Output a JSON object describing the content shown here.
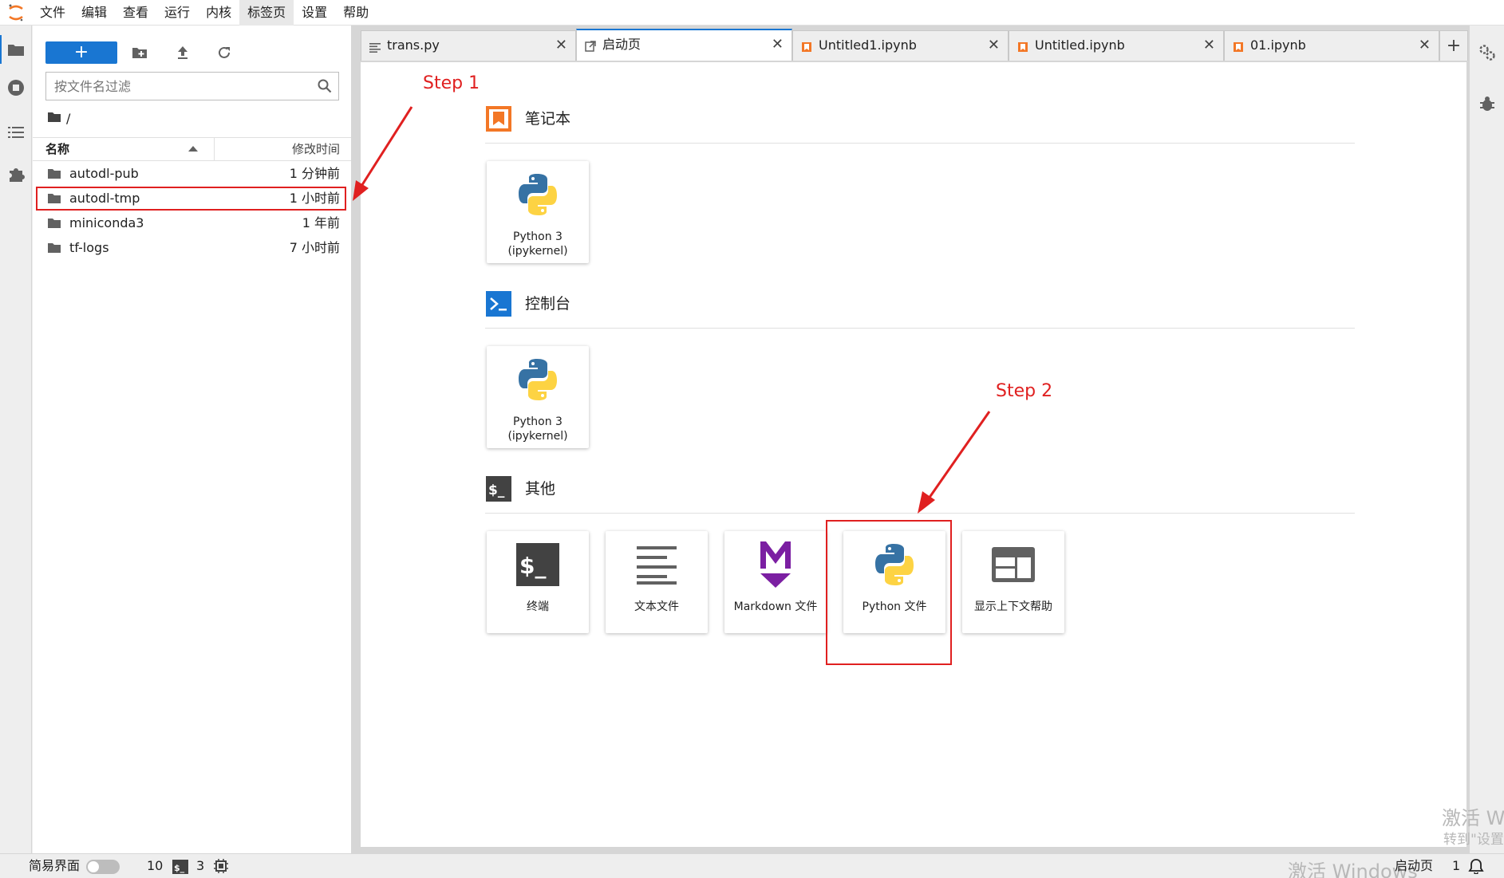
{
  "menu": {
    "items": [
      "文件",
      "编辑",
      "查看",
      "运行",
      "内核",
      "标签页",
      "设置",
      "帮助"
    ],
    "active_index": 5
  },
  "filebrowser": {
    "new_label": "+",
    "filter_placeholder": "按文件名过滤",
    "breadcrumb": "/",
    "header": {
      "name": "名称",
      "modified": "修改时间"
    },
    "files": [
      {
        "name": "autodl-pub",
        "modified": "1 分钟前"
      },
      {
        "name": "autodl-tmp",
        "modified": "1 小时前"
      },
      {
        "name": "miniconda3",
        "modified": "1 年前"
      },
      {
        "name": "tf-logs",
        "modified": "7 小时前"
      }
    ]
  },
  "tabs": [
    {
      "label": "trans.py",
      "icon": "text-file-icon"
    },
    {
      "label": "启动页",
      "icon": "launcher-icon",
      "current": true
    },
    {
      "label": "Untitled1.ipynb",
      "icon": "notebook-icon"
    },
    {
      "label": "Untitled.ipynb",
      "icon": "notebook-icon"
    },
    {
      "label": "01.ipynb",
      "icon": "notebook-icon"
    }
  ],
  "launcher": {
    "sections": [
      {
        "title": "笔记本",
        "icon": "notebook-section-icon",
        "cards": [
          {
            "label": "Python 3",
            "sub": "(ipykernel)",
            "icon": "python-logo-icon"
          }
        ]
      },
      {
        "title": "控制台",
        "icon": "console-section-icon",
        "cards": [
          {
            "label": "Python 3",
            "sub": "(ipykernel)",
            "icon": "python-logo-icon"
          }
        ]
      },
      {
        "title": "其他",
        "icon": "other-section-icon",
        "cards": [
          {
            "label": "终端",
            "icon": "terminal-icon"
          },
          {
            "label": "文本文件",
            "icon": "text-lines-icon"
          },
          {
            "label": "Markdown 文件",
            "icon": "markdown-icon"
          },
          {
            "label": "Python 文件",
            "icon": "python-logo-icon"
          },
          {
            "label": "显示上下文帮助",
            "icon": "context-help-icon"
          }
        ]
      }
    ]
  },
  "annotations": {
    "step1": "Step 1",
    "step2": "Step 2"
  },
  "statusbar": {
    "simple_mode_label": "简易界面",
    "terminals_count": "10",
    "kernels_count": "3",
    "current_tab": "启动页",
    "notifications": "1"
  },
  "watermark": {
    "line1": "激活 W",
    "line2": "转到\"设置",
    "line3": "激活 Windows"
  },
  "colors": {
    "accent": "#1976d2",
    "annotation": "#e02020",
    "notebook_orange": "#f37726",
    "markdown_purple": "#7b1fa2"
  }
}
